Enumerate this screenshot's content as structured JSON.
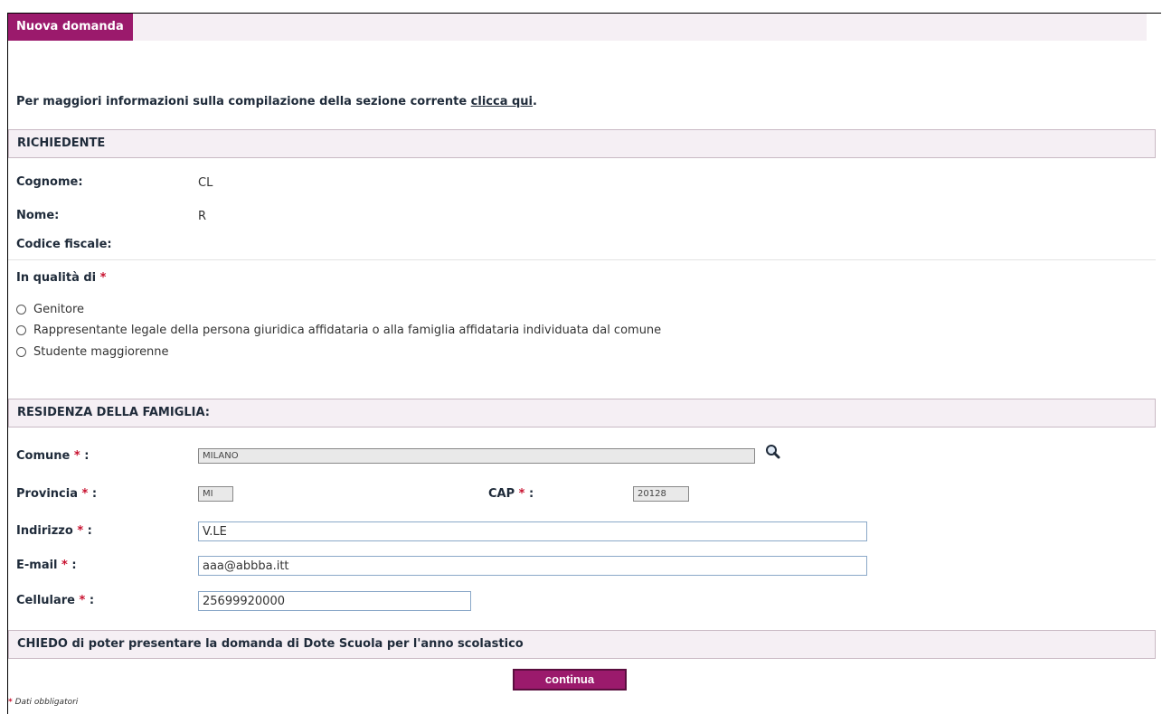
{
  "header": {
    "title": "Nuova domanda"
  },
  "info": {
    "prefix": "Per maggiori informazioni sulla compilazione della sezione corrente ",
    "link": "clicca qui",
    "suffix": "."
  },
  "richiedente": {
    "title": "RICHIEDENTE",
    "fields": [
      {
        "label": "Cognome:",
        "value": "CL"
      },
      {
        "label": "Nome:",
        "value": "R"
      },
      {
        "label": "Codice fiscale:",
        "value": ""
      }
    ]
  },
  "qualita": {
    "label": "In qualità di",
    "required": "*",
    "options": [
      "Genitore",
      "Rappresentante legale della persona giuridica affidataria o alla famiglia affidataria individuata dal comune",
      "Studente maggiorenne"
    ]
  },
  "residenza": {
    "title": "RESIDENZA DELLA FAMIGLIA:",
    "comune_label": "Comune",
    "comune_value": "MILANO",
    "provincia_label": "Provincia",
    "provincia_value": "MI",
    "cap_label": "CAP",
    "cap_value": "20128",
    "indirizzo_label": "Indirizzo",
    "indirizzo_value": "V.LE",
    "email_label": "E-mail",
    "email_value": "aaa@abbba.itt",
    "cellulare_label": "Cellulare",
    "cellulare_value": "25699920000",
    "required": "*",
    "colon": ":"
  },
  "chiedo": {
    "text": "CHIEDO di poter presentare la domanda di Dote Scuola per l'anno scolastico"
  },
  "actions": {
    "continue_label": "continua"
  },
  "footer": {
    "asterisk": "*",
    "text": " Dati obbligatori"
  }
}
